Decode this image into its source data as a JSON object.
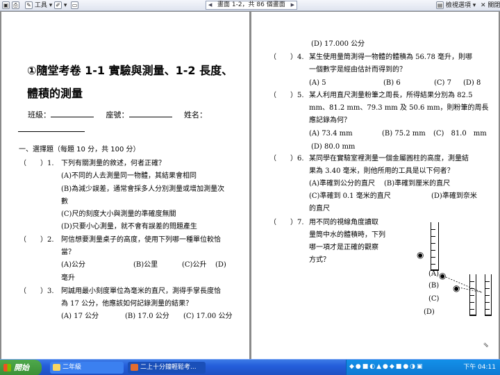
{
  "toolbar": {
    "tools_label": "工具",
    "page_indicator": "畫面 1-2，共 86 個畫面",
    "options_label": "檢視選項",
    "close_label": "關閉"
  },
  "left_page": {
    "title_line1": "①隨堂考卷 1-1 實驗與測量、1-2 長度、",
    "title_line2": "體積的測量",
    "class_label": "班級：",
    "seat_label": "座號：",
    "name_label": "姓名：",
    "section": "一、選擇題（每題 10 分，共 100 分）",
    "q1_paren": "（　　）1.",
    "q1_text": "下列有關測量的敘述，何者正確？",
    "q1_a": "(A)不同的人去測量同一物體，其結果會相同",
    "q1_b": "(B)為減少誤差，通常會採多人分別測量或增加測量次",
    "q1_b2": "數",
    "q1_c": "(C)尺的刻度大小與測量的準確度無關",
    "q1_d": "(D)只要小心測量，就不會有誤差的問題產生",
    "q2_paren": "（　　）2.",
    "q2_text": "阿信想要測量桌子的高度，使用下列哪一種單位較恰",
    "q2_text2": "當？",
    "q2_a": "(A)公分",
    "q2_b": "(B)公里",
    "q2_c": "(C)公升",
    "q2_d": "(D)",
    "q2_d2": "毫升",
    "q3_paren": "（　　）3.",
    "q3_text": "阿誠用最小刻度單位為毫米的直尺，測得手掌長度恰",
    "q3_text2": "為 17 公分，他應該如何記錄測量的結果？",
    "q3_a": "(A) 17 公分",
    "q3_b": "(B) 17.0 公分",
    "q3_c": "(C)  17.00 公分"
  },
  "right_page": {
    "q3_d": "(D) 17.000 公分",
    "q4_paren": "（　　）4.",
    "q4_text": "某生使用量筒測得一物體的體積為 56.78 毫升，則哪",
    "q4_text2": "一個數字是經由估計而得到的？",
    "q4_a": "(A) 5",
    "q4_b": "(B) 6",
    "q4_c": "(C) 7",
    "q4_d": "(D) 8",
    "q5_paren": "（　　）5.",
    "q5_text": "某人利用直尺測量粉筆之周長，所得結果分別為 82.5",
    "q5_text2": "mm、81.2 mm、79.3 mm 及 50.6 mm，則粉筆的周長",
    "q5_text3": "應記錄為何？",
    "q5_a": "(A) 73.4 mm",
    "q5_b": "(B) 75.2 mm",
    "q5_c": "(C)　81.0　mm",
    "q5_d": "(D) 80.0 mm",
    "q6_paren": "（　　）6.",
    "q6_text": "某同學在實驗室裡測量一個金屬圓柱的高度，測量結",
    "q6_text2": "果為 3.40 毫米，則他所用的工具是以下何者？",
    "q6_a": "(A)準確到公分的直尺",
    "q6_b": "(B)準確到厘米的直尺",
    "q6_c": "(C)準確到 0.1 毫米的直尺",
    "q6_d": "(D)準確到奈米",
    "q6_d2": "的直尺",
    "q7_paren": "（　　）7.",
    "q7_text": "用不同的視線角度讀取",
    "q7_text2": "量筒中水的體積時，下列",
    "q7_text3": "哪一項才是正確的觀察",
    "q7_text4": "方式？",
    "fig_a": "(A)",
    "fig_b": "(B)",
    "fig_c": "(C)",
    "fig_d": "(D)"
  },
  "taskbar": {
    "start_label": "開始",
    "task1": "二年級",
    "task2": "二上十分鐘輕鬆考...",
    "clock": "下午 04:11"
  }
}
